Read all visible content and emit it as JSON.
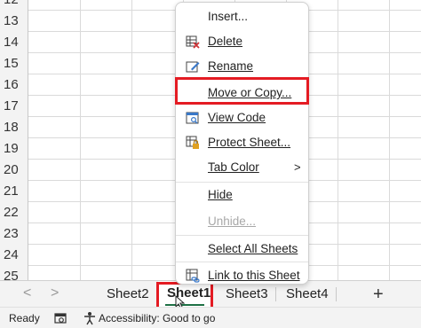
{
  "grid": {
    "row_numbers": [
      "12",
      "13",
      "14",
      "15",
      "16",
      "17",
      "18",
      "19",
      "20",
      "21",
      "22",
      "23",
      "24",
      "25"
    ]
  },
  "context_menu": {
    "items": [
      {
        "label": "Insert...",
        "icon": "none"
      },
      {
        "label": "Delete",
        "icon": "delete-icon"
      },
      {
        "label": "Rename",
        "icon": "rename-icon"
      },
      {
        "label": "Move or Copy...",
        "icon": "none"
      },
      {
        "label": "View Code",
        "icon": "view-code-icon"
      },
      {
        "label": "Protect Sheet...",
        "icon": "protect-sheet-icon"
      },
      {
        "label": "Tab Color",
        "icon": "none",
        "submenu": ">"
      },
      {
        "label": "Hide",
        "icon": "none"
      },
      {
        "label": "Unhide...",
        "icon": "none",
        "disabled": true
      },
      {
        "label": "Select All Sheets",
        "icon": "none"
      },
      {
        "label": "Link to this Sheet",
        "icon": "link-icon"
      }
    ],
    "highlight_color": "#e41b23"
  },
  "tabs": {
    "nav_prev": "<",
    "nav_next": ">",
    "sheets": [
      "Sheet2",
      "Sheet1",
      "Sheet3",
      "Sheet4"
    ],
    "active": "Sheet1",
    "add_label": "+",
    "active_color": "#1e7145"
  },
  "status": {
    "ready": "Ready",
    "accessibility": "Accessibility: Good to go"
  }
}
